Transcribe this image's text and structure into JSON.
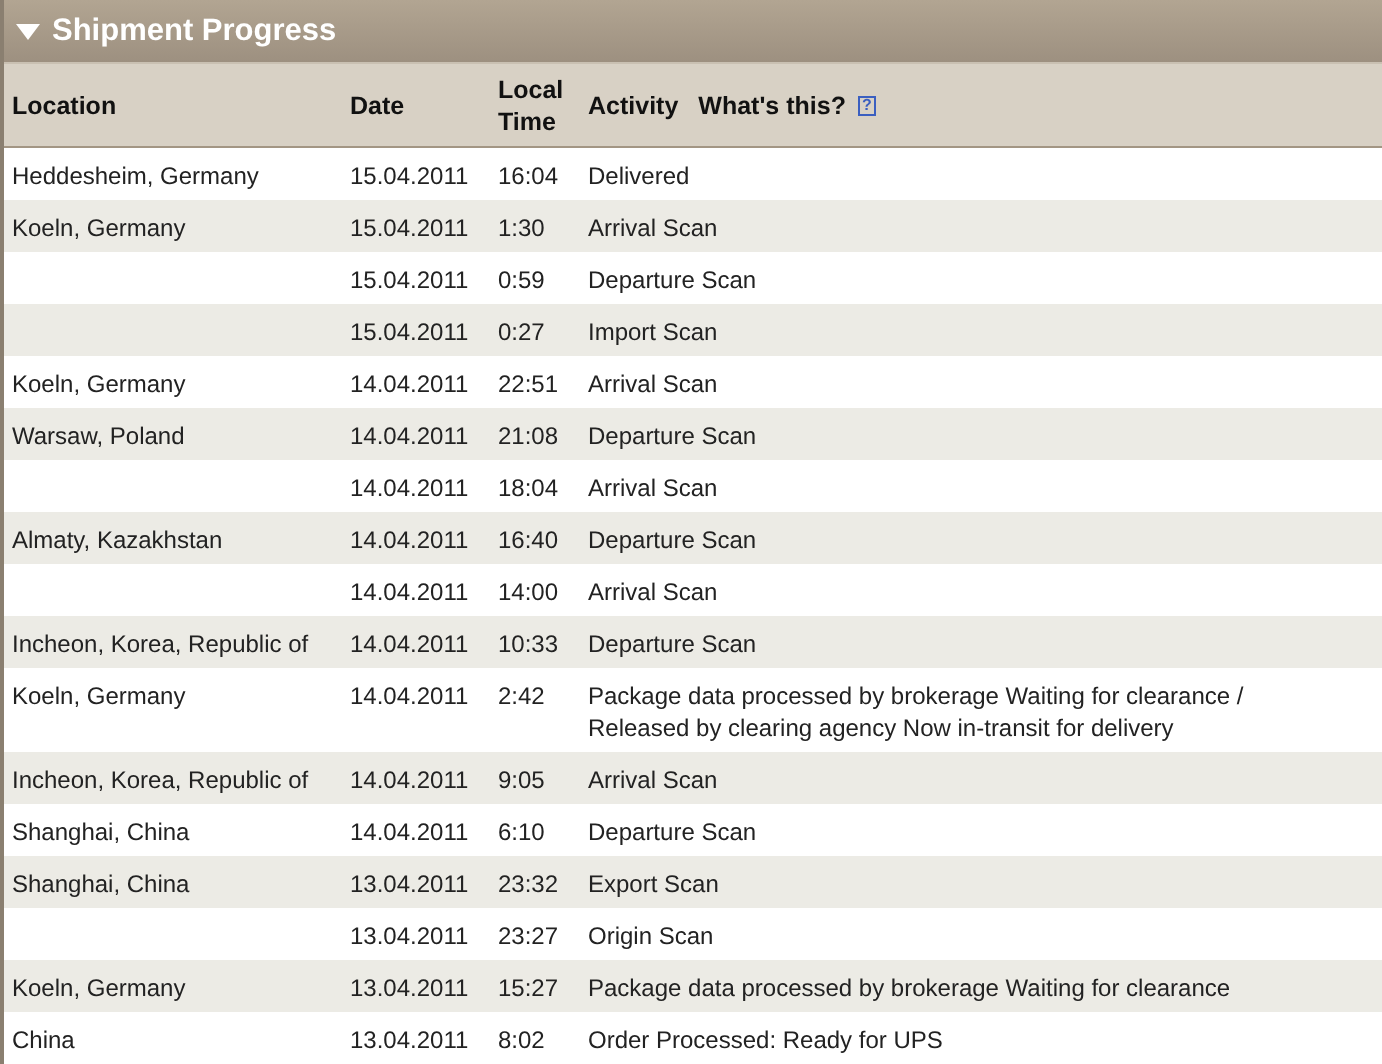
{
  "section": {
    "title": "Shipment Progress",
    "expanded": true
  },
  "columns": [
    {
      "label": "Location"
    },
    {
      "label": "Date"
    },
    {
      "label": "Local Time"
    },
    {
      "label": "Activity"
    }
  ],
  "help": {
    "label": "What's this?",
    "icon": "?"
  },
  "rows": [
    {
      "location": "Heddesheim, Germany",
      "date": "15.04.2011",
      "time": "16:04",
      "activity": "Delivered"
    },
    {
      "location": "Koeln, Germany",
      "date": "15.04.2011",
      "time": "1:30",
      "activity": "Arrival Scan"
    },
    {
      "date": "15.04.2011",
      "time": "0:59",
      "activity": "Departure Scan"
    },
    {
      "date": "15.04.2011",
      "time": "0:27",
      "activity": "Import Scan"
    },
    {
      "location": "Koeln, Germany",
      "date": "14.04.2011",
      "time": "22:51",
      "activity": "Arrival Scan"
    },
    {
      "location": "Warsaw, Poland",
      "date": "14.04.2011",
      "time": "21:08",
      "activity": "Departure Scan"
    },
    {
      "date": "14.04.2011",
      "time": "18:04",
      "activity": "Arrival Scan"
    },
    {
      "location": "Almaty, Kazakhstan",
      "date": "14.04.2011",
      "time": "16:40",
      "activity": "Departure Scan"
    },
    {
      "date": "14.04.2011",
      "time": "14:00",
      "activity": "Arrival Scan"
    },
    {
      "location": "Incheon, Korea, Republic of",
      "date": "14.04.2011",
      "time": "10:33",
      "activity": "Departure Scan"
    },
    {
      "location": "Koeln, Germany",
      "date": "14.04.2011",
      "time": "2:42",
      "activity": "Package data processed by brokerage Waiting for clearance / Released by clearing agency Now in-transit for delivery"
    },
    {
      "location": "Incheon, Korea, Republic of",
      "date": "14.04.2011",
      "time": "9:05",
      "activity": "Arrival Scan"
    },
    {
      "location": "Shanghai, China",
      "date": "14.04.2011",
      "time": "6:10",
      "activity": "Departure Scan"
    },
    {
      "location": "Shanghai, China",
      "date": "13.04.2011",
      "time": "23:32",
      "activity": "Export Scan"
    },
    {
      "date": "13.04.2011",
      "time": "23:27",
      "activity": "Origin Scan"
    },
    {
      "location": "Koeln, Germany",
      "date": "13.04.2011",
      "time": "15:27",
      "activity": "Package data processed by brokerage Waiting for clearance"
    },
    {
      "location": "China",
      "date": "13.04.2011",
      "time": "8:02",
      "activity": "Order Processed: Ready for UPS"
    }
  ]
}
